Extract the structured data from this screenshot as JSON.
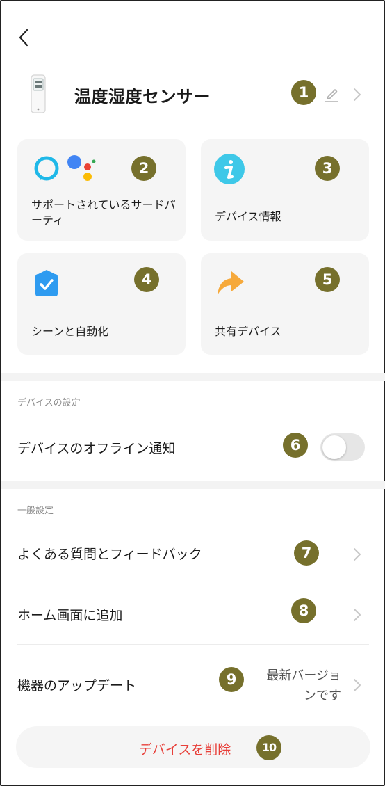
{
  "header": {
    "back_icon": "back-arrow-icon",
    "device_name": "温度湿度センサー",
    "device_image": "thermo-hygrometer-device",
    "edit_icon": "pencil-icon",
    "chevron_icon": "chevron-right-icon"
  },
  "cards": [
    {
      "label": "サポートされているサードパーティ",
      "icons": [
        "alexa-icon",
        "google-assistant-icon"
      ]
    },
    {
      "label": "デバイス情報",
      "icon": "info-icon"
    },
    {
      "label": "シーンと自動化",
      "icon": "automation-check-icon"
    },
    {
      "label": "共有デバイス",
      "icon": "share-arrow-icon"
    }
  ],
  "device_settings": {
    "section_title": "デバイスの設定",
    "offline_notification_label": "デバイスのオフライン通知",
    "offline_notification_enabled": false
  },
  "general_settings": {
    "section_title": "一般設定",
    "items": [
      {
        "label": "よくある質問とフィードバック"
      },
      {
        "label": "ホーム画面に追加"
      },
      {
        "label": "機器のアップデート",
        "status_line1": "最新バージョ",
        "status_line2": "ンです"
      }
    ]
  },
  "delete_button": {
    "label": "デバイスを削除"
  },
  "annotations": [
    "1",
    "2",
    "3",
    "4",
    "5",
    "6",
    "7",
    "8",
    "9",
    "10"
  ],
  "colors": {
    "badge": "#76702c",
    "delete_text": "#e8403a",
    "card_bg": "#f5f5f5",
    "info_icon": "#3ec8e8",
    "automation_icon": "#2e9bf0",
    "share_icon": "#f6a93b",
    "alexa": "#1fb8e8"
  }
}
